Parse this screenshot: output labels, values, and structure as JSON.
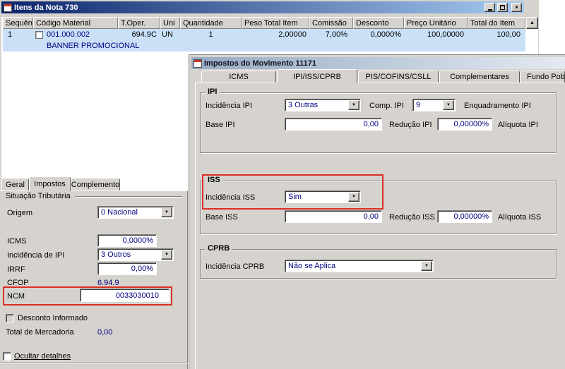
{
  "colors": {
    "accent_red": "#d93025",
    "value_text": "#000080",
    "selection": "#c9e0f7"
  },
  "icons": {
    "combo_arrow": "▼",
    "scroll_up": "▲",
    "close": "×"
  },
  "itens_window": {
    "title": "Itens da Nota 730",
    "table": {
      "headers": [
        "Sequência",
        "Código Material",
        "T.Oper.",
        "Uni",
        "Quantidade",
        "Peso Total Item",
        "Comissão",
        "Desconto",
        "Preço Unitário",
        "Total do Item"
      ],
      "row": {
        "cells": [
          "1",
          "001.000.002",
          "694.9C",
          "UN",
          "1",
          "2,00000",
          "7,00%",
          "0,0000%",
          "100,00000",
          "100,00"
        ],
        "description": "BANNER PROMOCIONAL"
      }
    },
    "detail_tabs": [
      "Geral",
      "Impostos",
      "Complemento"
    ],
    "form": {
      "group_title": "Situação Tributária",
      "origem_label": "Origem",
      "origem_value": "0 Nacional",
      "icms_label": "ICMS",
      "icms_value": "0,0000%",
      "incidencia_ipi_label": "Incidência de IPI",
      "incidencia_ipi_value": "3 Outros",
      "irrf_label": "IRRF",
      "irrf_value": "0,00%",
      "cfop_label": "CFOP",
      "cfop_value": "6.94.9",
      "ncm_label": "NCM",
      "ncm_value": "0033030010",
      "desconto_informado_label": "Desconto Informado",
      "total_mercadoria_label": "Total de Mercadoria",
      "total_mercadoria_value": "0,00"
    },
    "ocultar_detalhes_label": "Ocultar detalhes"
  },
  "impostos_window": {
    "title": "Impostos do Movimento 11171",
    "tabs": [
      "ICMS",
      "IPI/ISS/CPRB",
      "PIS/COFINS/CSLL",
      "Complementares",
      "Fundo Pobr"
    ],
    "ipi": {
      "group_title": "IPI",
      "incidencia_label": "Incidência IPI",
      "incidencia_value": "3 Outras",
      "comp_label": "Comp. IPI",
      "comp_value": "9",
      "enquadramento_label": "Enquadramento IPI",
      "base_label": "Base IPI",
      "base_value": "0,00",
      "reducao_label": "Redução IPI",
      "reducao_value": "0,00000%",
      "aliquota_label": "Alíquota IPI"
    },
    "iss": {
      "group_title": "ISS",
      "incidencia_label": "Incidência ISS",
      "incidencia_value": "Sim",
      "base_label": "Base ISS",
      "base_value": "0,00",
      "reducao_label": "Redução ISS",
      "reducao_value": "0,00000%",
      "aliquota_label": "Alíquota ISS"
    },
    "cprb": {
      "group_title": "CPRB",
      "incidencia_label": "Incidência CPRB",
      "incidencia_value": "Não se Aplica"
    }
  }
}
